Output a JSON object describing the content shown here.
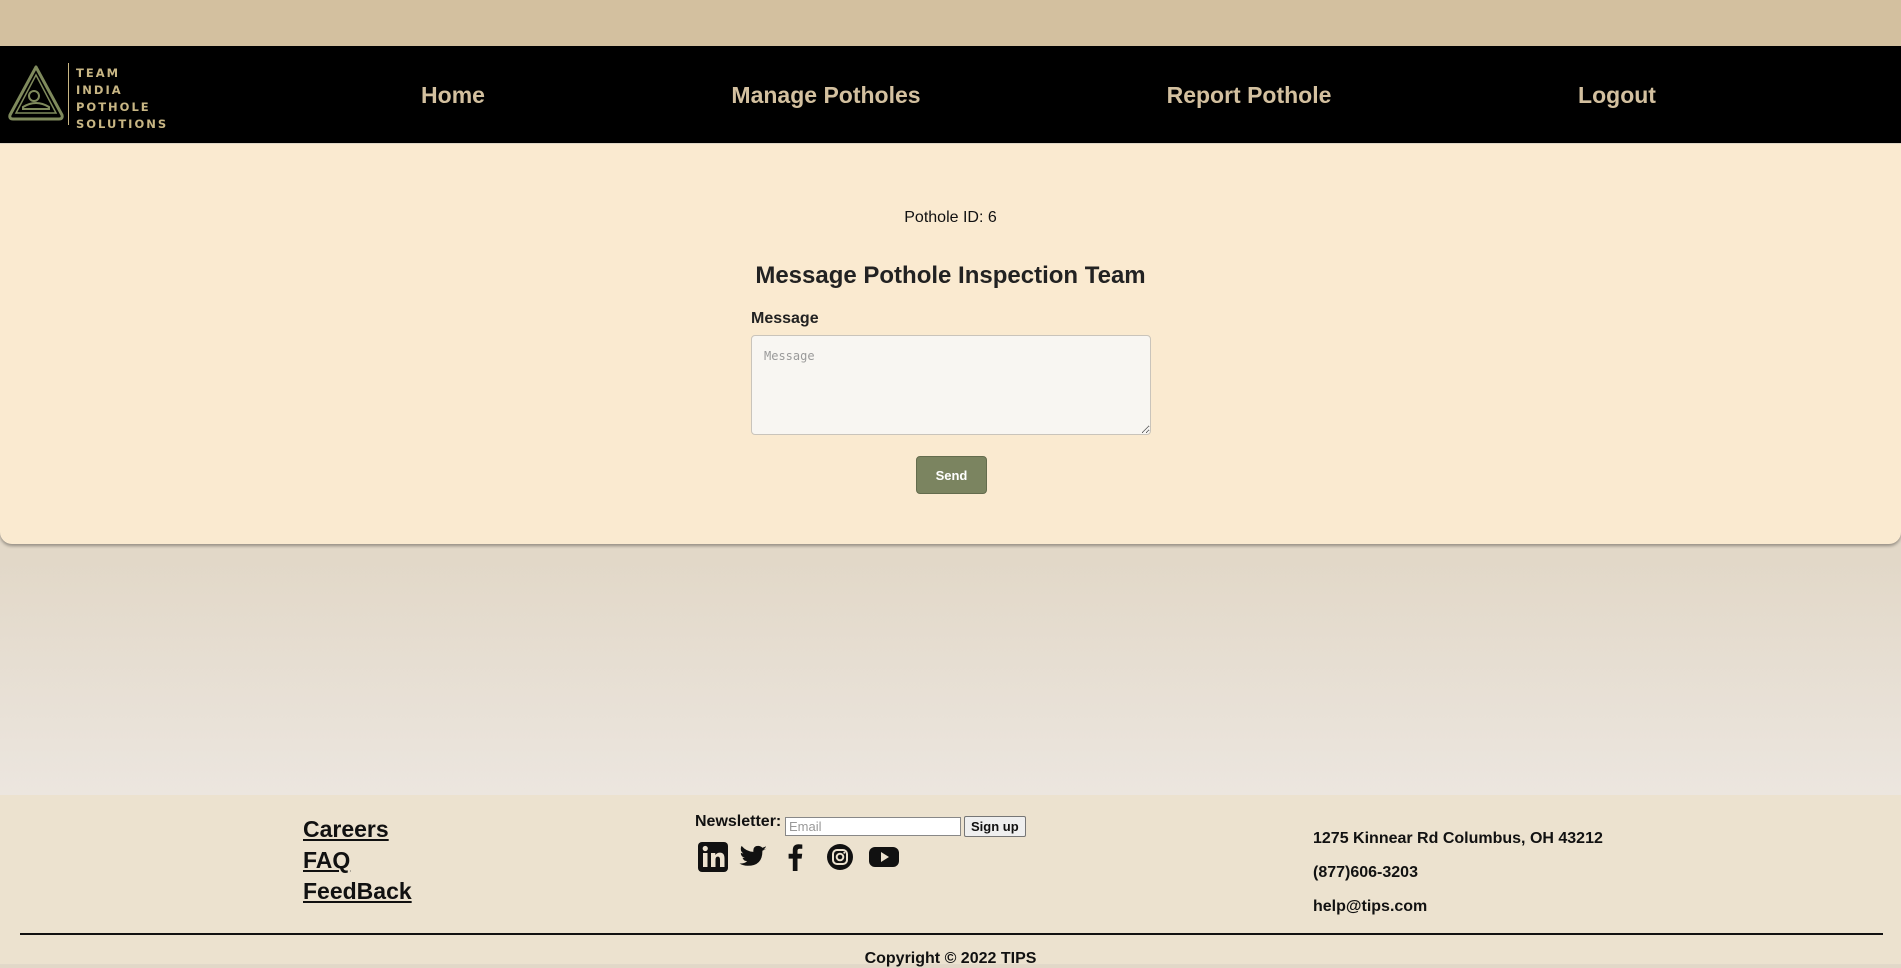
{
  "brand": {
    "logo_lines": [
      "TEAM",
      "INDIA",
      "POTHOLE",
      "SOLUTIONS"
    ]
  },
  "nav": {
    "home": "Home",
    "manage": "Manage Potholes",
    "report": "Report Pothole",
    "logout": "Logout"
  },
  "main": {
    "pothole_id": "Pothole ID: 6",
    "title": "Message Pothole Inspection Team",
    "message_label": "Message",
    "message_placeholder": "Message",
    "send_label": "Send"
  },
  "footer": {
    "links": [
      "Careers",
      "FAQ",
      "FeedBack"
    ],
    "newsletter_label": "Newsletter:",
    "email_placeholder": "Email",
    "signup_label": "Sign up",
    "social_icons": [
      "linkedin-icon",
      "twitter-icon",
      "facebook-icon",
      "instagram-icon",
      "youtube-icon"
    ],
    "address": "1275 Kinnear Rd Columbus, OH 43212",
    "phone": "(877)606-3203",
    "email": "help@tips.com",
    "copyright": "Copyright © 2022 TIPS"
  },
  "colors": {
    "top_band": "#d3c09f",
    "nav_bg": "#000000",
    "nav_text": "#d3c09f",
    "card_bg": "#faead0",
    "button_bg": "#7b8460",
    "footer_bg": "#ece2cf"
  }
}
